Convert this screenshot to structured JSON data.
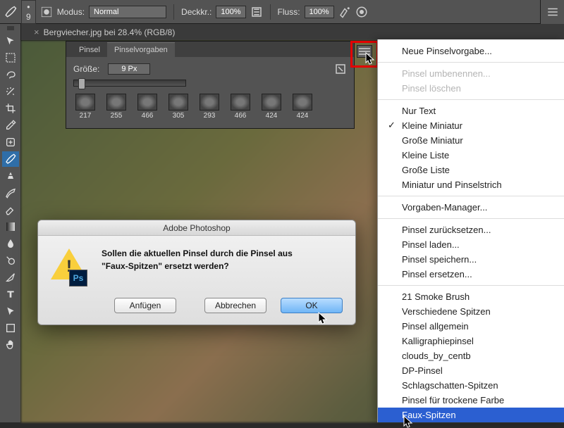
{
  "topbar": {
    "brush_size": "9",
    "mode_label": "Modus:",
    "mode_value": "Normal",
    "opacity_label": "Deckkr.:",
    "opacity_value": "100%",
    "flow_label": "Fluss:",
    "flow_value": "100%"
  },
  "document_tab": "Bergviecher.jpg bei 28.4% (RGB/8)",
  "brush_panel": {
    "tab_brush": "Pinsel",
    "tab_presets": "Pinselvorgaben",
    "size_label": "Größe:",
    "size_value": "9 Px",
    "thumbs": [
      "217",
      "255",
      "466",
      "305",
      "293",
      "466",
      "424",
      "424"
    ]
  },
  "dialog": {
    "title": "Adobe Photoshop",
    "message_line1": "Sollen die aktuellen Pinsel durch die Pinsel aus",
    "message_line2": "\"Faux-Spitzen\" ersetzt werden?",
    "ps_badge": "Ps",
    "btn_append": "Anfügen",
    "btn_cancel": "Abbrechen",
    "btn_ok": "OK"
  },
  "context_menu": {
    "items": [
      {
        "label": "Neue Pinselvorgabe...",
        "type": "item"
      },
      {
        "type": "sep"
      },
      {
        "label": "Pinsel umbenennen...",
        "type": "disabled"
      },
      {
        "label": "Pinsel löschen",
        "type": "disabled"
      },
      {
        "type": "sep"
      },
      {
        "label": "Nur Text",
        "type": "item"
      },
      {
        "label": "Kleine Miniatur",
        "type": "check"
      },
      {
        "label": "Große Miniatur",
        "type": "item"
      },
      {
        "label": "Kleine Liste",
        "type": "item"
      },
      {
        "label": "Große Liste",
        "type": "item"
      },
      {
        "label": "Miniatur und Pinselstrich",
        "type": "item"
      },
      {
        "type": "sep"
      },
      {
        "label": "Vorgaben-Manager...",
        "type": "item"
      },
      {
        "type": "sep"
      },
      {
        "label": "Pinsel zurücksetzen...",
        "type": "item"
      },
      {
        "label": "Pinsel laden...",
        "type": "item"
      },
      {
        "label": "Pinsel speichern...",
        "type": "item"
      },
      {
        "label": "Pinsel ersetzen...",
        "type": "item"
      },
      {
        "type": "sep"
      },
      {
        "label": "21 Smoke Brush",
        "type": "item"
      },
      {
        "label": "Verschiedene Spitzen",
        "type": "item"
      },
      {
        "label": "Pinsel allgemein",
        "type": "item"
      },
      {
        "label": "Kalligraphiepinsel",
        "type": "item"
      },
      {
        "label": "clouds_by_centb",
        "type": "item"
      },
      {
        "label": "DP-Pinsel",
        "type": "item"
      },
      {
        "label": "Schlagschatten-Spitzen",
        "type": "item"
      },
      {
        "label": "Pinsel für trockene Farbe",
        "type": "item"
      },
      {
        "label": "Faux-Spitzen",
        "type": "selected"
      }
    ]
  }
}
